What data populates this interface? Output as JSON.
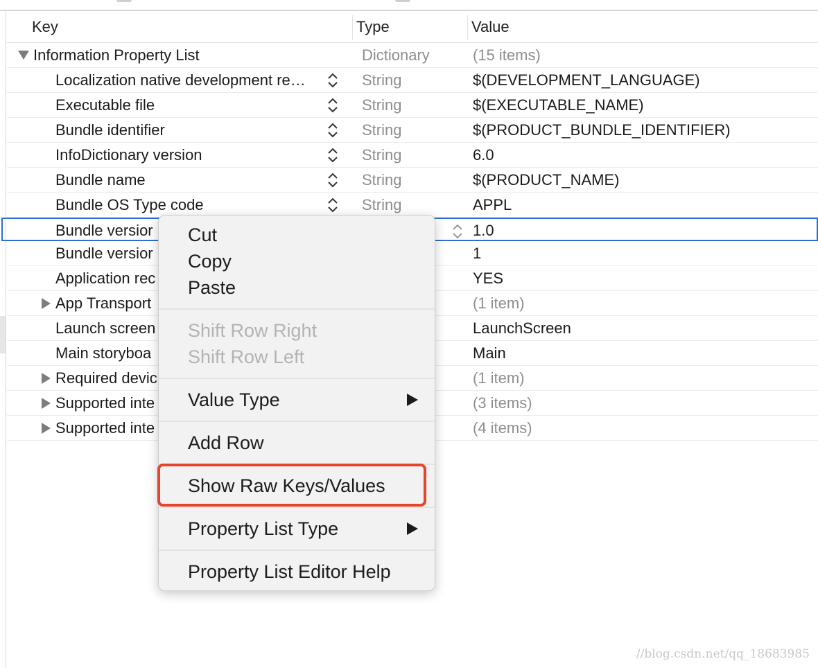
{
  "header": {
    "key_label": "Key",
    "type_label": "Type",
    "value_label": "Value"
  },
  "rows": [
    {
      "key": "Information Property List",
      "type": "Dictionary",
      "value": "(15 items)",
      "disclosure": "expanded"
    },
    {
      "key": "Localization native development re…",
      "type": "String",
      "value": "$(DEVELOPMENT_LANGUAGE)"
    },
    {
      "key": "Executable file",
      "type": "String",
      "value": "$(EXECUTABLE_NAME)"
    },
    {
      "key": "Bundle identifier",
      "type": "String",
      "value": "$(PRODUCT_BUNDLE_IDENTIFIER)"
    },
    {
      "key": "InfoDictionary version",
      "type": "String",
      "value": "6.0"
    },
    {
      "key": "Bundle name",
      "type": "String",
      "value": "$(PRODUCT_NAME)"
    },
    {
      "key": "Bundle OS Type code",
      "type": "String",
      "value": "APPL"
    },
    {
      "key": "Bundle versior",
      "type": "",
      "value": "1.0",
      "selected": true
    },
    {
      "key": "Bundle versior",
      "type": "",
      "value": "1"
    },
    {
      "key": "Application rec",
      "type": "",
      "value": "YES"
    },
    {
      "key": "App Transport",
      "type": "",
      "value": "(1 item)",
      "disclosure": "collapsed"
    },
    {
      "key": "Launch screen",
      "type": "",
      "value": "LaunchScreen"
    },
    {
      "key": "Main storyboa",
      "type": "",
      "value": "Main"
    },
    {
      "key": "Required devic",
      "type": "",
      "value": "(1 item)",
      "disclosure": "collapsed"
    },
    {
      "key": "Supported inte",
      "type": "",
      "value": "(3 items)",
      "disclosure": "collapsed"
    },
    {
      "key": "Supported inte",
      "type": "",
      "value": "(4 items)",
      "disclosure": "collapsed"
    }
  ],
  "context_menu": {
    "cut": "Cut",
    "copy": "Copy",
    "paste": "Paste",
    "shift_row_right": "Shift Row Right",
    "shift_row_left": "Shift Row Left",
    "value_type": "Value Type",
    "add_row": "Add Row",
    "show_raw": "Show Raw Keys/Values",
    "property_list_type": "Property List Type",
    "editor_help": "Property List Editor Help"
  },
  "highlight_color": "#e8442a",
  "selection_color": "#2d6cd6",
  "watermark": "//blog.csdn.net/qq_18683985"
}
